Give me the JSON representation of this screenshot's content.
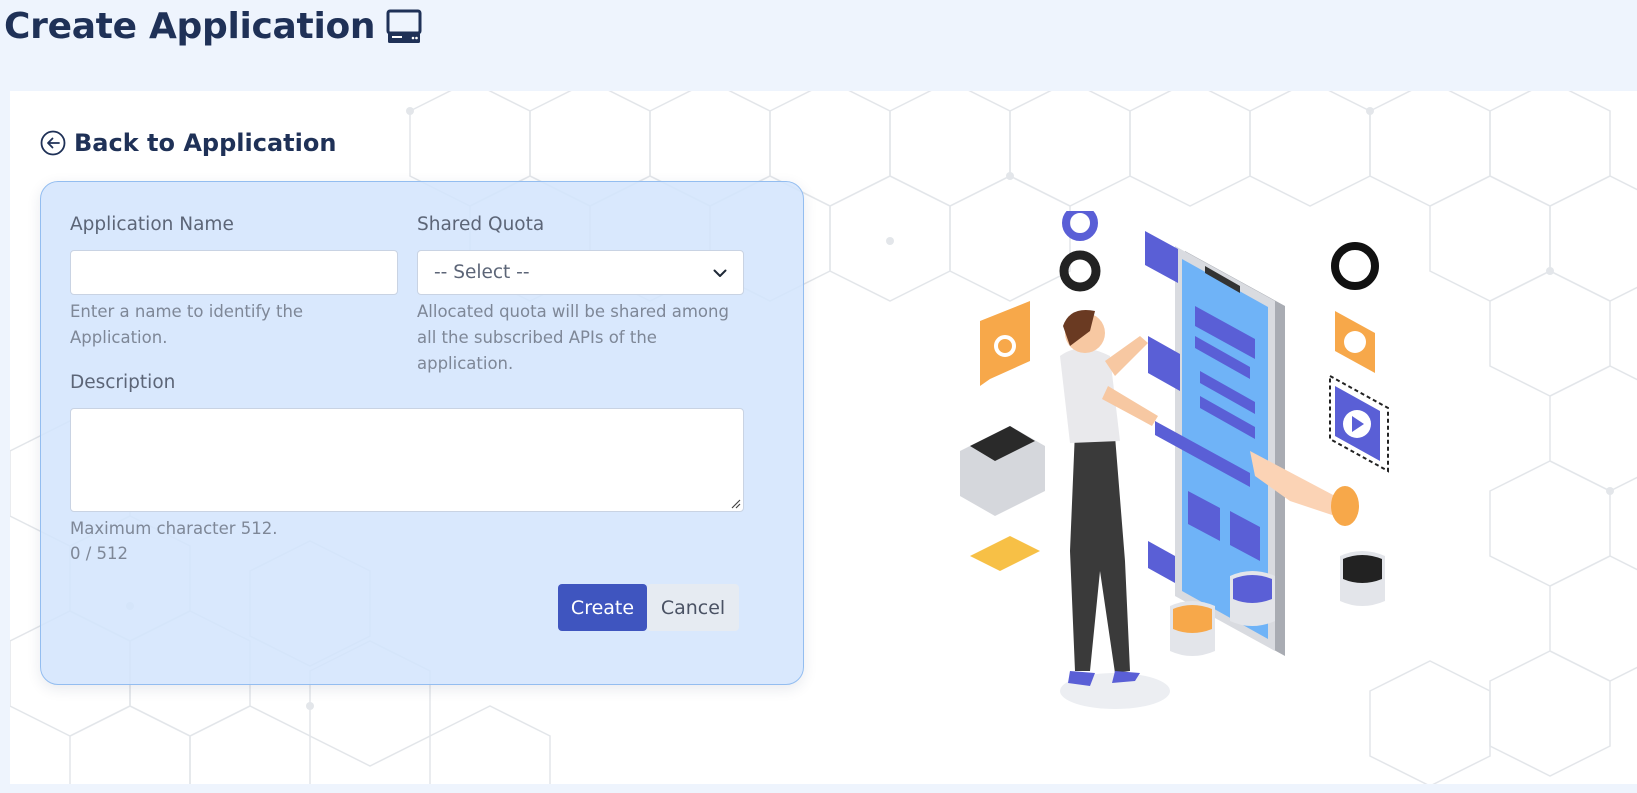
{
  "header": {
    "title": "Create Application",
    "title_icon": "computer-icon"
  },
  "back_link": {
    "label": "Back to Application",
    "icon": "arrow-left-circle-icon"
  },
  "form": {
    "app_name": {
      "label": "Application Name",
      "value": "",
      "placeholder": "",
      "help": "Enter a name to identify the Application."
    },
    "shared_quota": {
      "label": "Shared Quota",
      "selected": "-- Select --",
      "help": "Allocated quota will be shared among all the subscribed APIs of the application."
    },
    "description": {
      "label": "Description",
      "value": "",
      "max_help": "Maximum character 512.",
      "counter": "0 / 512"
    },
    "buttons": {
      "create": "Create",
      "cancel": "Cancel"
    }
  },
  "colors": {
    "primary": "#3f55bf",
    "title": "#1f3157",
    "card_bg": "#d2e4fd",
    "card_border": "#93bdf0",
    "page_bg": "#eef4fd"
  }
}
